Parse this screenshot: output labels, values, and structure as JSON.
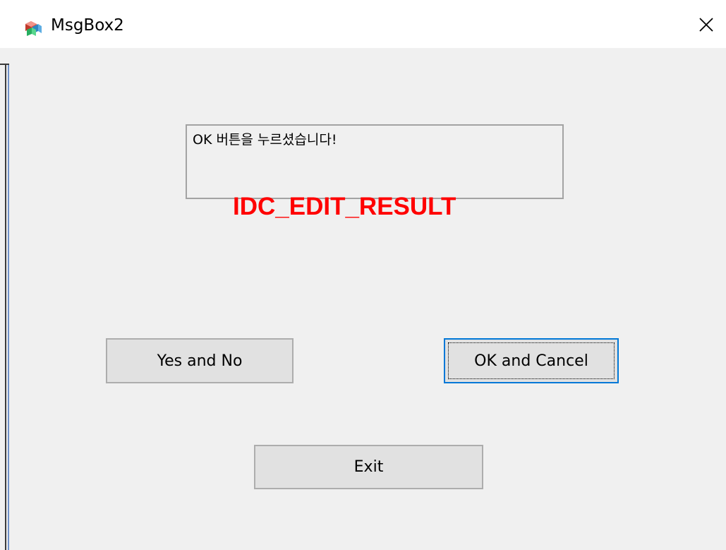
{
  "window": {
    "title": "MsgBox2",
    "app_icon": "dialog-app-icon",
    "close_icon": "close-icon"
  },
  "edit_result": {
    "value": "OK 버튼을 누르셨습니다!"
  },
  "annotation": {
    "text": "IDC_EDIT_RESULT",
    "color": "#ff0000"
  },
  "buttons": {
    "yes_and_no": "Yes and No",
    "ok_and_cancel": "OK and Cancel",
    "exit": "Exit"
  },
  "colors": {
    "focus_border": "#0078d7",
    "button_face": "#e1e1e1",
    "dialog_background": "#f0f0f0"
  }
}
